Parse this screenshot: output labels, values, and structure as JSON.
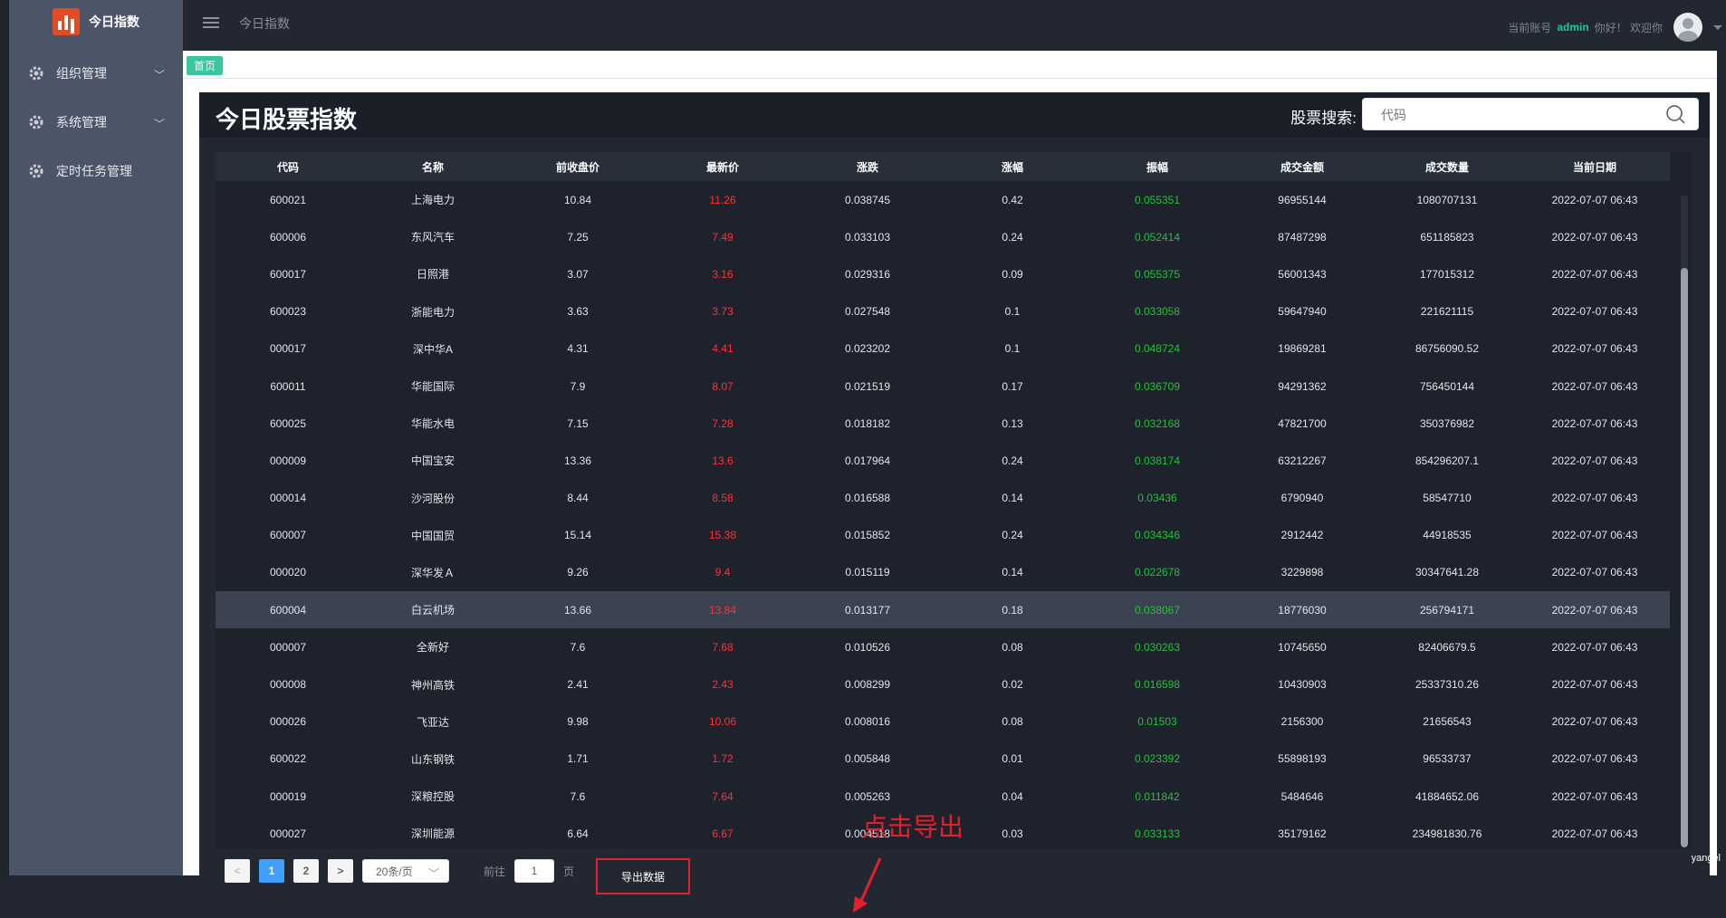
{
  "app": {
    "logo_text": "今日指数"
  },
  "sidebar": {
    "items": [
      {
        "label": "组织管理",
        "expandable": true
      },
      {
        "label": "系统管理",
        "expandable": true
      },
      {
        "label": "定时任务管理",
        "expandable": false
      }
    ]
  },
  "topbar": {
    "title": "今日指数",
    "account_prefix": "当前账号",
    "username": "admin",
    "greeting": "你好！ 欢迎你"
  },
  "breadcrumb": {
    "home": "首页"
  },
  "panel": {
    "title": "今日股票指数",
    "search_label": "股票搜索:",
    "search_placeholder": "代码"
  },
  "table": {
    "columns": [
      "代码",
      "名称",
      "前收盘价",
      "最新价",
      "涨跌",
      "涨幅",
      "振幅",
      "成交金额",
      "成交数量",
      "当前日期"
    ],
    "rows": [
      [
        "600021",
        "上海电力",
        "10.84",
        "11.26",
        "0.038745",
        "0.42",
        "0.055351",
        "96955144",
        "1080707131",
        "2022-07-07 06:43"
      ],
      [
        "600006",
        "东风汽车",
        "7.25",
        "7.49",
        "0.033103",
        "0.24",
        "0.052414",
        "87487298",
        "651185823",
        "2022-07-07 06:43"
      ],
      [
        "600017",
        "日照港",
        "3.07",
        "3.16",
        "0.029316",
        "0.09",
        "0.055375",
        "56001343",
        "177015312",
        "2022-07-07 06:43"
      ],
      [
        "600023",
        "浙能电力",
        "3.63",
        "3.73",
        "0.027548",
        "0.1",
        "0.033058",
        "59647940",
        "221621115",
        "2022-07-07 06:43"
      ],
      [
        "000017",
        "深中华A",
        "4.31",
        "4.41",
        "0.023202",
        "0.1",
        "0.048724",
        "19869281",
        "86756090.52",
        "2022-07-07 06:43"
      ],
      [
        "600011",
        "华能国际",
        "7.9",
        "8.07",
        "0.021519",
        "0.17",
        "0.036709",
        "94291362",
        "756450144",
        "2022-07-07 06:43"
      ],
      [
        "600025",
        "华能水电",
        "7.15",
        "7.28",
        "0.018182",
        "0.13",
        "0.032168",
        "47821700",
        "350376982",
        "2022-07-07 06:43"
      ],
      [
        "000009",
        "中国宝安",
        "13.36",
        "13.6",
        "0.017964",
        "0.24",
        "0.038174",
        "63212267",
        "854296207.1",
        "2022-07-07 06:43"
      ],
      [
        "000014",
        "沙河股份",
        "8.44",
        "8.58",
        "0.016588",
        "0.14",
        "0.03436",
        "6790940",
        "58547710",
        "2022-07-07 06:43"
      ],
      [
        "600007",
        "中国国贸",
        "15.14",
        "15.38",
        "0.015852",
        "0.24",
        "0.034346",
        "2912442",
        "44918535",
        "2022-07-07 06:43"
      ],
      [
        "000020",
        "深华发Ａ",
        "9.26",
        "9.4",
        "0.015119",
        "0.14",
        "0.022678",
        "3229898",
        "30347641.28",
        "2022-07-07 06:43"
      ],
      [
        "600004",
        "白云机场",
        "13.66",
        "13.84",
        "0.013177",
        "0.18",
        "0.038067",
        "18776030",
        "256794171",
        "2022-07-07 06:43"
      ],
      [
        "000007",
        "全新好",
        "7.6",
        "7.68",
        "0.010526",
        "0.08",
        "0.030263",
        "10745650",
        "82406679.5",
        "2022-07-07 06:43"
      ],
      [
        "000008",
        "神州高铁",
        "2.41",
        "2.43",
        "0.008299",
        "0.02",
        "0.016598",
        "10430903",
        "25337310.26",
        "2022-07-07 06:43"
      ],
      [
        "000026",
        "飞亚达",
        "9.98",
        "10.06",
        "0.008016",
        "0.08",
        "0.01503",
        "2156300",
        "21656543",
        "2022-07-07 06:43"
      ],
      [
        "600022",
        "山东钢铁",
        "1.71",
        "1.72",
        "0.005848",
        "0.01",
        "0.023392",
        "55898193",
        "96533737",
        "2022-07-07 06:43"
      ],
      [
        "000019",
        "深粮控股",
        "7.6",
        "7.64",
        "0.005263",
        "0.04",
        "0.011842",
        "5484646",
        "41884652.06",
        "2022-07-07 06:43"
      ],
      [
        "000027",
        "深圳能源",
        "6.64",
        "6.67",
        "0.004518",
        "0.03",
        "0.033133",
        "35179162",
        "234981830.76",
        "2022-07-07 06:43"
      ]
    ],
    "highlighted_row": 11
  },
  "pagination": {
    "prev": "<",
    "pages": [
      "1",
      "2"
    ],
    "current_page": "1",
    "next": ">",
    "page_size": "20条/页",
    "goto_prefix": "前往",
    "goto_value": "1",
    "goto_suffix": "页",
    "export_label": "导出数据"
  },
  "annotation": {
    "text": "点击导出"
  },
  "watermark": "yangel"
}
